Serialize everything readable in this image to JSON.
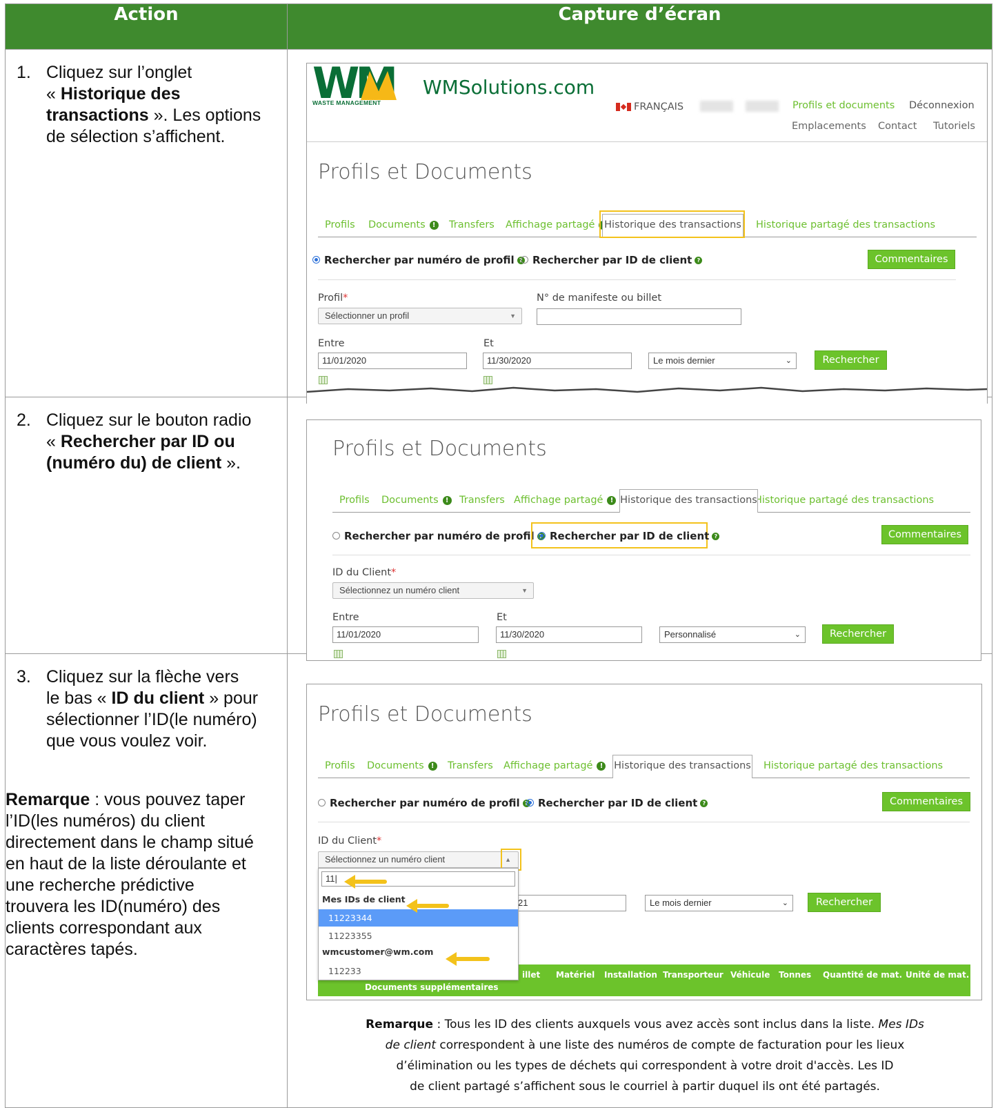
{
  "header": {
    "col1": "Action",
    "col2": "Capture d’écran"
  },
  "step1": {
    "num": "1.",
    "t1": "Cliquez sur l’onglet",
    "t2": "« ",
    "b1": "Historique des",
    "b2": "transactions",
    "t3": " ».  Les options",
    "t4": "de sélection s’affichent."
  },
  "step2": {
    "num": "2.",
    "t1": "Cliquez sur le bouton radio",
    "t2": "« ",
    "b1": "Rechercher par ID ou",
    "b2": "(numéro du) de client",
    "t3": " »."
  },
  "step3": {
    "num": "3.",
    "t1": "Cliquez sur la flèche vers",
    "t2": "le bas « ",
    "b1": "ID du client",
    "t3": " » pour",
    "t4": "sélectionner l’ID(le numéro)",
    "t5": "que vous voulez voir."
  },
  "remark_left": {
    "bold": "Remarque",
    "l1": " : vous pouvez taper",
    "l2": "l’ID(les numéros) du client",
    "l3": "directement dans le champ situé",
    "l4": "en haut de la liste déroulante et",
    "l5": "une recherche prédictive",
    "l6": "trouvera les ID(numéro) des",
    "l7": "clients correspondant aux",
    "l8": "caractères tapés."
  },
  "site": {
    "logo_letters": "WM",
    "logo_sub": "WASTE MANAGEMENT",
    "domain": "WMSolutions.com",
    "lang": "FRANÇAIS",
    "nav1": "Profils et documents",
    "nav2": "Déconnexion",
    "nav3": "Emplacements",
    "nav4": "Contact",
    "nav5": "Tutoriels"
  },
  "page_title": "Profils et Documents",
  "tabs": {
    "profils": "Profils",
    "documents": "Documents",
    "transfers": "Transfers",
    "affichage": "Affichage partagé",
    "historique": "Historique des transactions",
    "historique_partage": "Historique partagé des transactions"
  },
  "info_glyph": "!",
  "help_glyph": "?",
  "radio_profil": "Rechercher par numéro de profil",
  "radio_client": "Rechercher par ID de client",
  "commentaires": "Commentaires",
  "rechercher": "Rechercher",
  "required_mark": "*",
  "s1": {
    "profil_label": "Profil",
    "profil_select": "Sélectionner un profil",
    "manifest_label": "N° de manifeste ou billet",
    "entre": "Entre",
    "et": "Et",
    "date_from": "11/01/2020",
    "date_to": "11/30/2020",
    "period": "Le mois dernier"
  },
  "s2": {
    "client_label": "ID du Client",
    "client_select": "Sélectionnez un numéro client",
    "entre": "Entre",
    "et": "Et",
    "date_from": "11/01/2020",
    "date_to": "11/30/2020",
    "period": "Personnalisé"
  },
  "s3": {
    "client_label": "ID du Client",
    "client_select": "Sélectionnez un numéro client",
    "search_value": "11|",
    "group_mine": "Mes IDs de client",
    "options_mine": [
      "11223344",
      "11223355"
    ],
    "group_shared": "wmcustomer@wm.com",
    "options_shared": [
      "112233"
    ],
    "date_partial": "21",
    "period": "Le mois dernier",
    "table_headers": [
      "illet",
      "Matériel",
      "Installation",
      "Transporteur",
      "Véhicule",
      "Tonnes",
      "Quantité de mat.",
      "Unité de mat."
    ],
    "table_sub": "Documents supplémentaires"
  },
  "remark_bottom": {
    "bold": "Remarque",
    "l1a": " : Tous les ID des clients auxquels vous avez accès sont inclus dans la liste. ",
    "l1i": "Mes IDs",
    "l2i": "de client",
    "l2": " correspondent à une liste des numéros de compte de facturation pour les lieux",
    "l3": "d’élimination ou les types de déchets qui correspondent à votre droit d'accès. Les ID",
    "l4": "de client partagé s’affichent sous le courriel à partir duquel ils ont été partagés."
  },
  "colors": {
    "header_green": "#3f8a2e",
    "link_green": "#6cbf2f",
    "button_green": "#6cc32b",
    "highlight_yellow": "#f3c21b",
    "select_blue": "#5b9bf8"
  }
}
